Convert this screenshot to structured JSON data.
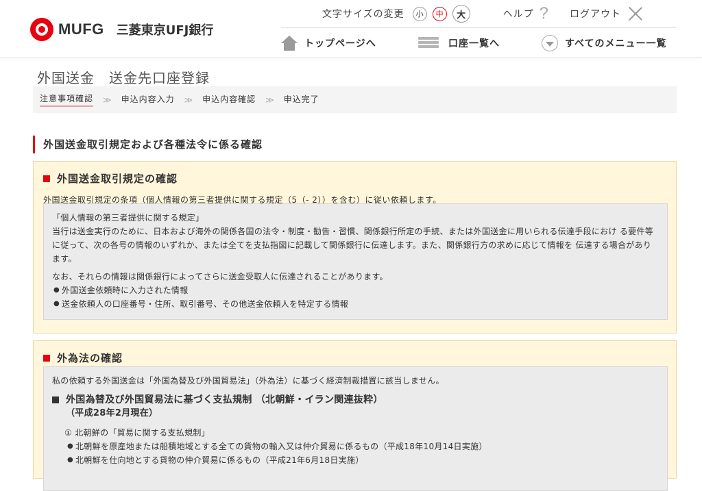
{
  "header": {
    "logo_text": "MUFG",
    "bank_name": "三菱東京UFJ銀行",
    "font_size_label": "文字サイズの変更",
    "font_size_small": "小",
    "font_size_medium": "中",
    "font_size_large": "大",
    "help_label": "ヘルプ",
    "logout_label": "ログアウト",
    "nav": {
      "top_page": "トップページへ",
      "account_list": "口座一覧へ",
      "all_menu": "すべてのメニュー一覧"
    }
  },
  "page": {
    "title": "外国送金　送金先口座登録",
    "steps": [
      "注意事項確認",
      "申込内容入力",
      "申込内容確認",
      "申込完了"
    ],
    "step_separator": "≫",
    "section_title": "外国送金取引規定および各種法令に係る確認"
  },
  "box1": {
    "heading": "外国送金取引規定の確認",
    "description": "外国送金取引規定の条項（個人情報の第三者提供に関する規定（5（- 2））を含む）に従い依頼します。",
    "inner_title": "「個人情報の第三者提供に関する規定」",
    "inner_body": "当行は送金実行のために、日本および海外の関係各国の法令・制度・勧告・習慣、関係銀行所定の手続、または外国送金に用いられる伝達手段におけ る要件等に従って、次の各号の情報のいずれか、または全てを支払指図に記載して関係銀行に伝達します。また、関係銀行方の求めに応じて情報を 伝達する場合があります。",
    "inner_note": "なお、それらの情報は関係銀行によってさらに送金受取人に伝達されることがあります。",
    "bullets": [
      "外国送金依頼時に入力された情報",
      "送金依頼人の口座番号・住所、取引番号、その他送金依頼人を特定する情報"
    ]
  },
  "box2": {
    "heading": "外為法の確認",
    "intro": "私の依頼する外国送金は「外国為替及び外国貿易法」（外為法）に基づく経済制裁措置に該当しません。",
    "law_heading": "外国為替及び外国貿易法に基づく支払規制 （北朝鮮・イラン関連抜粋）",
    "law_date": "（平成28年2月現在）",
    "item_title": "① 北朝鮮の「貿易に関する支払規制」",
    "items": [
      "北朝鮮を原産地または船積地域とする全ての貨物の輸入又は仲介貿易に係るもの（平成18年10月14日実施）",
      "北朝鮮を仕向地とする貨物の仲介貿易に係るもの（平成21年6月18日実施）"
    ]
  },
  "colors": {
    "brand_red": "#e60012",
    "notice_bg": "#fff6dc",
    "inner_bg": "#ebebeb"
  }
}
